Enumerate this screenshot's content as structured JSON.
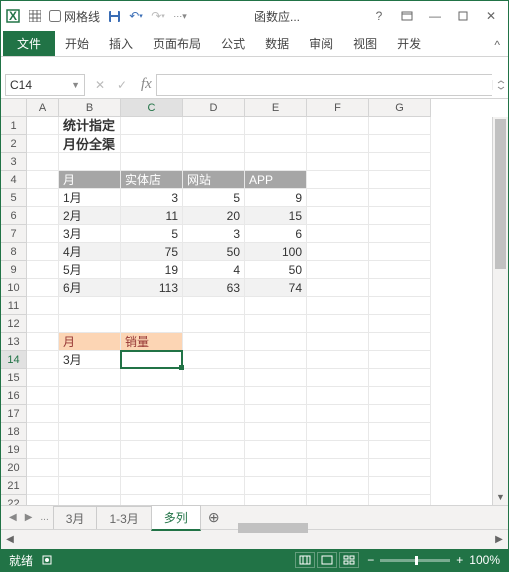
{
  "qat": {
    "gridlines_label": "网格线"
  },
  "title": "函数应...",
  "ribbon": {
    "file": "文件",
    "tabs": [
      "开始",
      "插入",
      "页面布局",
      "公式",
      "数据",
      "审阅",
      "视图",
      "开发"
    ]
  },
  "namebox": "C14",
  "columns": [
    "A",
    "B",
    "C",
    "D",
    "E",
    "F",
    "G"
  ],
  "row_count": 24,
  "content": {
    "title": "统计指定月份全渠道销量",
    "headers": [
      "月",
      "实体店",
      "网站",
      "APP"
    ],
    "rows": [
      {
        "m": "1月",
        "a": 3,
        "b": 5,
        "c": 9
      },
      {
        "m": "2月",
        "a": 11,
        "b": 20,
        "c": 15
      },
      {
        "m": "3月",
        "a": 5,
        "b": 3,
        "c": 6
      },
      {
        "m": "4月",
        "a": 75,
        "b": 50,
        "c": 100
      },
      {
        "m": "5月",
        "a": 19,
        "b": 4,
        "c": 50
      },
      {
        "m": "6月",
        "a": 113,
        "b": 63,
        "c": 74
      }
    ],
    "lookup": {
      "h1": "月",
      "h2": "销量",
      "val": "3月"
    }
  },
  "sheets": {
    "tabs": [
      "3月",
      "1-3月",
      "多列"
    ],
    "active": 2,
    "ellipsis": "..."
  },
  "status": {
    "ready": "就绪",
    "zoom": "100%"
  },
  "chart_data": {
    "type": "table",
    "title": "统计指定月份全渠道销量",
    "columns": [
      "月",
      "实体店",
      "网站",
      "APP"
    ],
    "rows": [
      [
        "1月",
        3,
        5,
        9
      ],
      [
        "2月",
        11,
        20,
        15
      ],
      [
        "3月",
        5,
        3,
        6
      ],
      [
        "4月",
        75,
        50,
        100
      ],
      [
        "5月",
        19,
        4,
        50
      ],
      [
        "6月",
        113,
        63,
        74
      ]
    ]
  }
}
